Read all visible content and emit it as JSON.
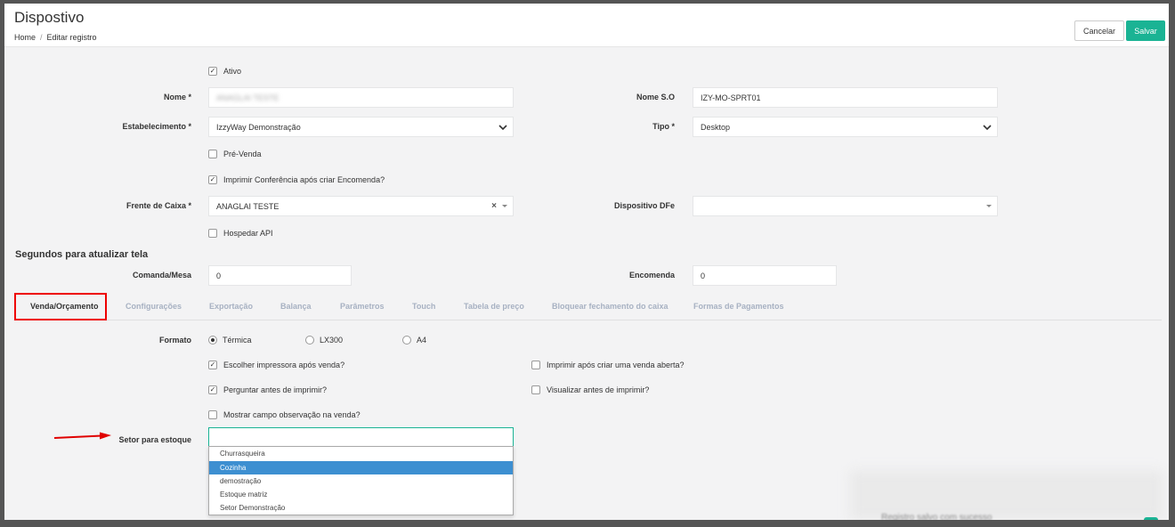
{
  "header": {
    "title": "Dispostivo",
    "breadcrumb": {
      "home": "Home",
      "separator": "/",
      "current": "Editar registro"
    },
    "cancel_label": "Cancelar",
    "save_label": "Salvar"
  },
  "form": {
    "ativo": {
      "label": "Ativo",
      "checked": true
    },
    "nome": {
      "label": "Nome *",
      "value": "ANAGLAI TESTE"
    },
    "nome_so": {
      "label": "Nome S.O",
      "value": "IZY-MO-SPRT01"
    },
    "estabelecimento": {
      "label": "Estabelecimento *",
      "value": "IzzyWay Demonstração"
    },
    "tipo": {
      "label": "Tipo *",
      "value": "Desktop"
    },
    "pre_venda": {
      "label": "Pré-Venda",
      "checked": false
    },
    "imprimir_conferencia": {
      "label": "Imprimir Conferência após criar Encomenda?",
      "checked": true
    },
    "frente_caixa": {
      "label": "Frente de Caixa *",
      "value": "ANAGLAI TESTE",
      "clear": "×"
    },
    "dispositivo_dfe": {
      "label": "Dispositivo DFe",
      "value": ""
    },
    "hospedar_api": {
      "label": "Hospedar API",
      "checked": false
    },
    "section_title": "Segundos para atualizar tela",
    "comanda_mesa": {
      "label": "Comanda/Mesa",
      "value": "0"
    },
    "encomenda": {
      "label": "Encomenda",
      "value": "0"
    }
  },
  "tabs": [
    {
      "label": "Venda/Orçamento",
      "active": true
    },
    {
      "label": "Configurações"
    },
    {
      "label": "Exportação"
    },
    {
      "label": "Balança"
    },
    {
      "label": "Parâmetros"
    },
    {
      "label": "Touch"
    },
    {
      "label": "Tabela de preço"
    },
    {
      "label": "Bloquear fechamento do caixa"
    },
    {
      "label": "Formas de Pagamentos"
    }
  ],
  "venda": {
    "formato_label": "Formato",
    "formato_options": [
      {
        "label": "Térmica",
        "selected": true
      },
      {
        "label": "LX300",
        "selected": false
      },
      {
        "label": "A4",
        "selected": false
      }
    ],
    "escolher_impressora": {
      "label": "Escolher impressora após venda?",
      "checked": true
    },
    "imprimir_venda_aberta": {
      "label": "Imprimir após criar uma venda aberta?",
      "checked": false
    },
    "perguntar_antes": {
      "label": "Perguntar antes de imprimir?",
      "checked": true
    },
    "visualizar_antes": {
      "label": "Visualizar antes de imprimir?",
      "checked": false
    },
    "mostrar_observacao": {
      "label": "Mostrar campo observação na venda?",
      "checked": false
    },
    "setor_label": "Setor para estoque",
    "setor_value": "",
    "setor_options": [
      "Churrasqueira",
      "Cozinha",
      "demostração",
      "Estoque matriz",
      "Setor Demonstração"
    ],
    "setor_highlighted": "Cozinha"
  },
  "toast": {
    "text": "Registro salvo com sucesso"
  },
  "colors": {
    "accent": "#1ab394",
    "highlight": "#3d8fd1",
    "annotation": "#e00000",
    "tab_inactive": "#a7b1c2"
  }
}
